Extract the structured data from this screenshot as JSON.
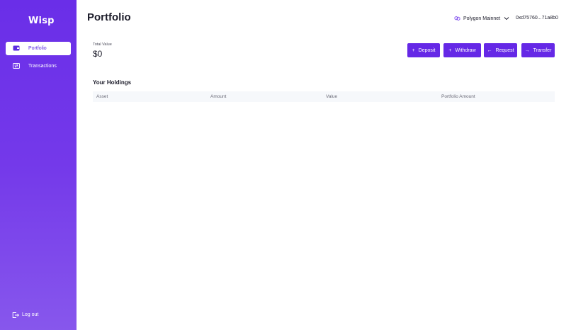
{
  "sidebar": {
    "logo": "Wisp",
    "items": [
      {
        "label": "Portfolio",
        "icon": "wallet-icon",
        "active": true
      },
      {
        "label": "Transactions",
        "icon": "transactions-icon",
        "active": false
      }
    ],
    "logout_label": "Log out"
  },
  "header": {
    "title": "Portfolio",
    "network": "Polygon Mainnet",
    "wallet_address": "0xd75760...71a8b0"
  },
  "summary": {
    "total_label": "Total Value",
    "total_value": "$0"
  },
  "actions": [
    {
      "label": "Deposit",
      "glyph": "+"
    },
    {
      "label": "Withdraw",
      "glyph": "+"
    },
    {
      "label": "Request",
      "glyph": "←"
    },
    {
      "label": "Transfer",
      "glyph": "→"
    }
  ],
  "holdings": {
    "title": "Your Holdings",
    "columns": [
      "Asset",
      "Amount",
      "Value",
      "Portfolio Amount"
    ]
  },
  "colors": {
    "brand": "#6528e6",
    "sidebar_top": "#6a2ee8",
    "sidebar_bottom": "#8757ec"
  }
}
